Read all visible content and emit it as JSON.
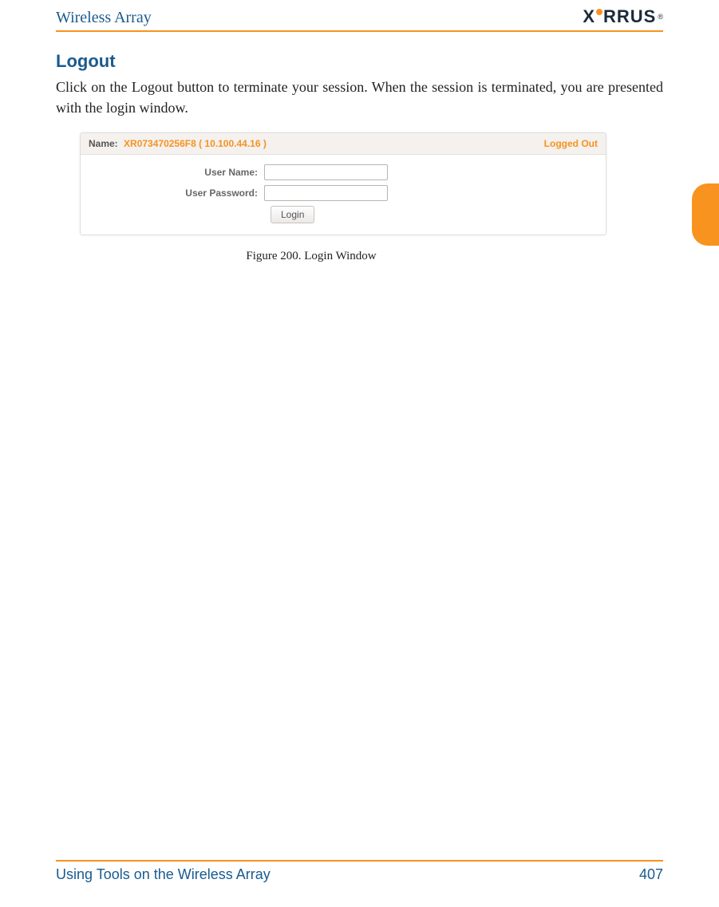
{
  "header": {
    "title": "Wireless Array",
    "logo_text_1": "X",
    "logo_text_2": "RRUS",
    "logo_reg": "®"
  },
  "section": {
    "heading": "Logout",
    "body": "Click on the Logout button to terminate your session. When the session is terminated, you are presented with the login window."
  },
  "login_window": {
    "name_label": "Name:",
    "name_value": "XR073470256F8   ( 10.100.44.16 )",
    "status": "Logged Out",
    "username_label": "User Name:",
    "password_label": "User Password:",
    "username_value": "",
    "password_value": "",
    "login_button": "Login"
  },
  "figure_caption": "Figure 200. Login Window",
  "footer": {
    "left": "Using Tools on the Wireless Array",
    "page": "407"
  }
}
